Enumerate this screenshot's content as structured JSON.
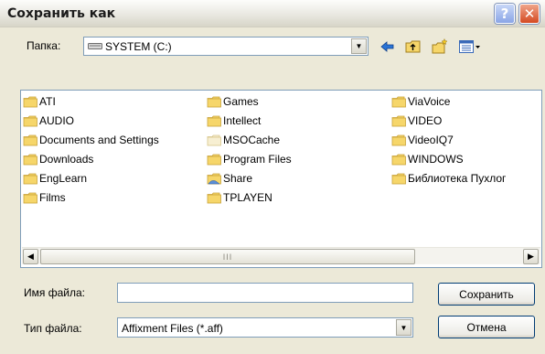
{
  "window": {
    "title": "Сохранить как",
    "help_label": "?",
    "close_label": "✕"
  },
  "lookin": {
    "label": "Папка:",
    "value": "SYSTEM (C:)",
    "icon": "drive-icon"
  },
  "toolbar": [
    "back-icon",
    "up-folder-icon",
    "new-folder-icon",
    "view-menu-icon"
  ],
  "files": {
    "columns": [
      [
        "ATI",
        "AUDIO",
        "Documents and Settings",
        "Downloads",
        "EngLearn",
        "Films"
      ],
      [
        "Games",
        "Intellect",
        "MSOCache",
        "Program Files",
        "Share",
        "TPLAYEN"
      ],
      [
        "ViaVoice",
        "VIDEO",
        "VideoIQ7",
        "WINDOWS",
        "Библиотека Пухлог"
      ]
    ],
    "scroll_grip": "III"
  },
  "filename": {
    "label": "Имя файла:",
    "value": ""
  },
  "filetype": {
    "label": "Тип файла:",
    "value": "Affixment Files (*.aff)"
  },
  "buttons": {
    "save": "Сохранить",
    "cancel": "Отмена"
  },
  "colors": {
    "folder": "#f6d66a",
    "folder_dark": "#c9a33a",
    "border": "#7f9db9"
  }
}
